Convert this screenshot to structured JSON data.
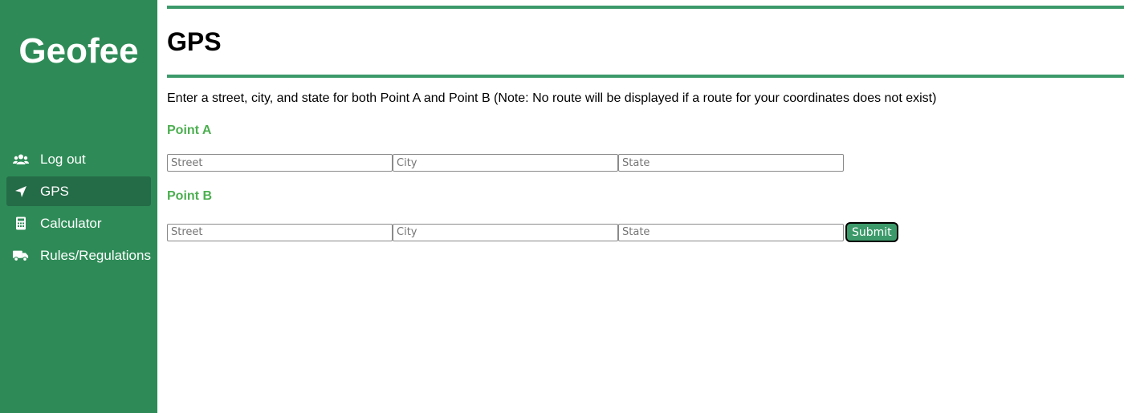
{
  "sidebar": {
    "brand": "Geofee",
    "items": [
      {
        "label": "Log out",
        "icon": "users-icon",
        "active": false
      },
      {
        "label": "GPS",
        "icon": "location-arrow-icon",
        "active": true
      },
      {
        "label": "Calculator",
        "icon": "calculator-icon",
        "active": false
      },
      {
        "label": "Rules/Regulations",
        "icon": "truck-icon",
        "active": false
      }
    ]
  },
  "main": {
    "title": "GPS",
    "instructions": "Enter a street, city, and state for both Point A and Point B (Note: No route will be displayed if a route for your coordinates does not exist)",
    "point_a": {
      "heading": "Point A",
      "street_placeholder": "Street",
      "city_placeholder": "City",
      "state_placeholder": "State"
    },
    "point_b": {
      "heading": "Point B",
      "street_placeholder": "Street",
      "city_placeholder": "City",
      "state_placeholder": "State"
    },
    "submit_label": "Submit"
  },
  "colors": {
    "sidebar_bg": "#2e8b57",
    "active_item_bg": "#246b47",
    "accent_rule": "#3c9a6a",
    "section_heading": "#4caf50"
  }
}
